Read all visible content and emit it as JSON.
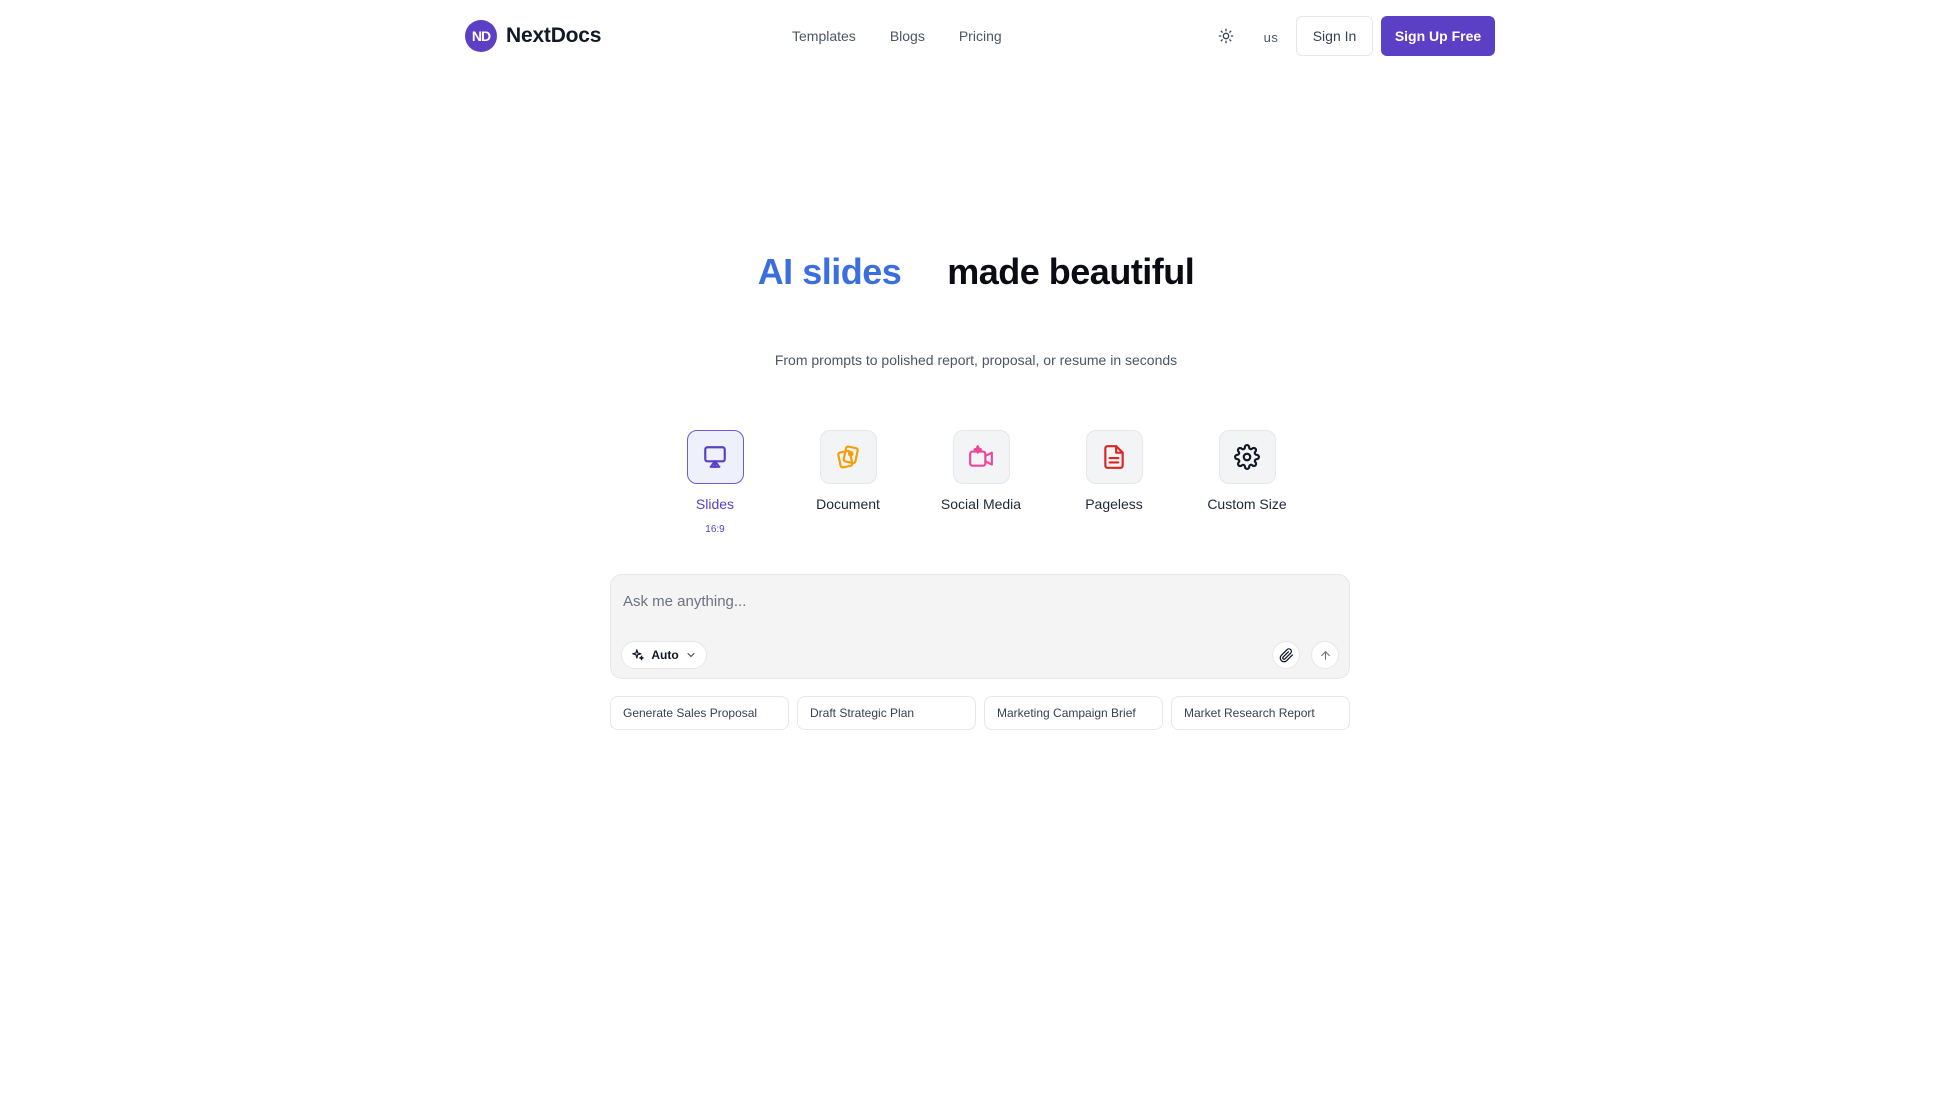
{
  "header": {
    "brand": {
      "mark": "ND",
      "name": "NextDocs",
      "color": "#5b3fc4"
    },
    "nav": [
      "Templates",
      "Blogs",
      "Pricing"
    ],
    "theme_icon": "sun-icon",
    "language": "us",
    "sign_in": "Sign In",
    "sign_up": "Sign Up Free"
  },
  "hero": {
    "title_accent": "AI slides",
    "title_rest": "made beautiful",
    "subtitle": "From prompts to polished report, proposal, or resume in seconds",
    "accent_color": "#3b6fe0"
  },
  "formats": [
    {
      "label": "Slides",
      "icon": "presentation-icon",
      "color": "#5b3fc4",
      "active": true,
      "ratio": "16:9"
    },
    {
      "label": "Document",
      "icon": "cards-icon",
      "color": "#f59e0b",
      "active": false
    },
    {
      "label": "Social Media",
      "icon": "video-sparkle-icon",
      "color": "#ec4899",
      "active": false
    },
    {
      "label": "Pageless",
      "icon": "file-text-icon",
      "color": "#dc2626",
      "active": false
    },
    {
      "label": "Custom Size",
      "icon": "gear-icon",
      "color": "#111827",
      "active": false
    }
  ],
  "prompt": {
    "placeholder": "Ask me anything...",
    "mode": "Auto",
    "mode_icon": "sparkles-icon",
    "attach_icon": "paperclip-icon",
    "send_icon": "arrow-up-icon"
  },
  "suggestions": [
    "Generate Sales Proposal",
    "Draft Strategic Plan",
    "Marketing Campaign Brief",
    "Market Research Report"
  ]
}
